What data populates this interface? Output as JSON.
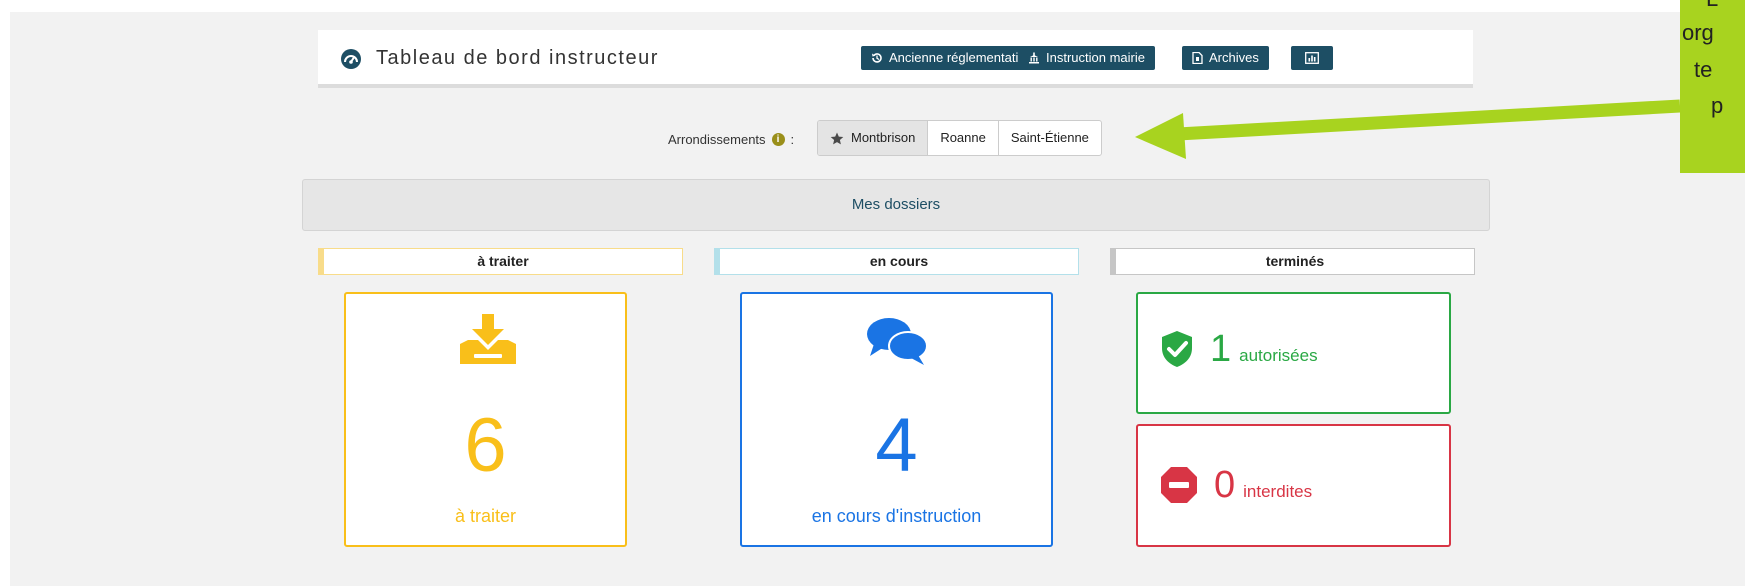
{
  "header": {
    "title": "Tableau de bord instructeur",
    "buttons": {
      "ancienne": "Ancienne réglementation",
      "mairie": "Instruction mairie",
      "archives": "Archives"
    }
  },
  "arrondissements": {
    "label": "Arrondissements",
    "separator": ":",
    "info": "i",
    "options": [
      "Montbrison",
      "Roanne",
      "Saint-Étienne"
    ],
    "selected": "Montbrison"
  },
  "section": {
    "title": "Mes dossiers"
  },
  "columns": {
    "a_traiter": "à traiter",
    "en_cours": "en cours",
    "termines": "terminés"
  },
  "cards": {
    "a_traiter": {
      "count": "6",
      "label": "à traiter",
      "color": "#f9bf1a"
    },
    "en_cours": {
      "count": "4",
      "label": "en cours d'instruction",
      "color": "#1a74e4"
    },
    "autorisees": {
      "count": "1",
      "label": "autorisées",
      "color": "#2aa844"
    },
    "interdites": {
      "count": "0",
      "label": "interdites",
      "color": "#d83545"
    }
  },
  "annotation": {
    "lines": [
      "L",
      "org",
      "te",
      "p"
    ],
    "color": "#a8d31f"
  }
}
